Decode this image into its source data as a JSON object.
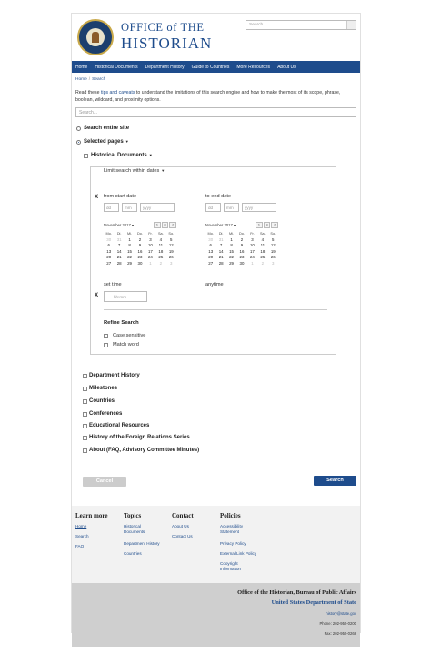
{
  "header": {
    "title_line1": "OFFICE of THE",
    "title_line2": "HISTORIAN",
    "search_placeholder": "Search..."
  },
  "nav": [
    "Home",
    "Historical Documents",
    "Department History",
    "Guide to Countries",
    "More Resources",
    "About Us"
  ],
  "breadcrumb": [
    "Home",
    "Search"
  ],
  "intro": {
    "before": "Read these ",
    "link": "tips and caveats",
    "after": " to understand the limitations of this search engine and how to make the most of its scope, phrase, boolean, wildcard, and proximity options."
  },
  "main_search_placeholder": "Search...",
  "scope": {
    "entire_site": "Search entire site",
    "selected_pages": "Selected pages"
  },
  "historical_documents": "Historical Documents",
  "date_panel": {
    "limit_label": "Limit search within dates",
    "x": "X",
    "from_label": "from start date",
    "to_label": "to end date",
    "dd": "dd",
    "mm": "mm",
    "yyyy": "yyyy",
    "set_time": "set time",
    "anytime": "anytime",
    "hhmm": "hh:mm",
    "refine": "Refine Search",
    "case_sensitive": "Case sensitive",
    "match_word": "Match word"
  },
  "calendar": {
    "month": "November 2017",
    "buttons": [
      "<",
      "o",
      ">"
    ],
    "weekdays": [
      "Mo.",
      "Di.",
      "Mi.",
      "Do.",
      "Fr.",
      "Sa.",
      "So."
    ],
    "days": [
      "30",
      "31",
      "1",
      "2",
      "3",
      "4",
      "5",
      "6",
      "7",
      "8",
      "9",
      "10",
      "11",
      "12",
      "13",
      "14",
      "15",
      "16",
      "17",
      "18",
      "19",
      "20",
      "21",
      "22",
      "23",
      "24",
      "25",
      "26",
      "27",
      "28",
      "29",
      "30",
      "1",
      "2",
      "3"
    ],
    "other_month": [
      0,
      1,
      32,
      33,
      34
    ]
  },
  "sections": [
    "Department History",
    "Milestones",
    "Countries",
    "Conferences",
    "Educational Resources",
    "History of the Foreign Relations Series",
    "About (FAQ, Advisory Committee Minutes)"
  ],
  "buttons": {
    "cancel": "Cancel",
    "search": "Search"
  },
  "footer": {
    "learn_more": {
      "title": "Learn more",
      "links": [
        "Home",
        "Search",
        "FAQ"
      ]
    },
    "topics": {
      "title": "Topics",
      "links": [
        "Historical Documents",
        "Department History",
        "Countries"
      ]
    },
    "contact": {
      "title": "Contact",
      "links": [
        "About Us",
        "Contact Us"
      ]
    },
    "policies": {
      "title": "Policies",
      "links": [
        "Accessibility Statement",
        "Privacy Policy",
        "External Link Policy",
        "Copyright Information"
      ]
    }
  },
  "footer_bottom": {
    "line1": "Office of the Historian, Bureau of Public Affairs",
    "line2": "United States Department of State",
    "email": "history@state.gov",
    "phone": "Phone: 202-955-0200",
    "fax": "Fax: 202-955-0268"
  },
  "colors": {
    "brand": "#1e4c8c",
    "cancel": "#cccccc"
  }
}
